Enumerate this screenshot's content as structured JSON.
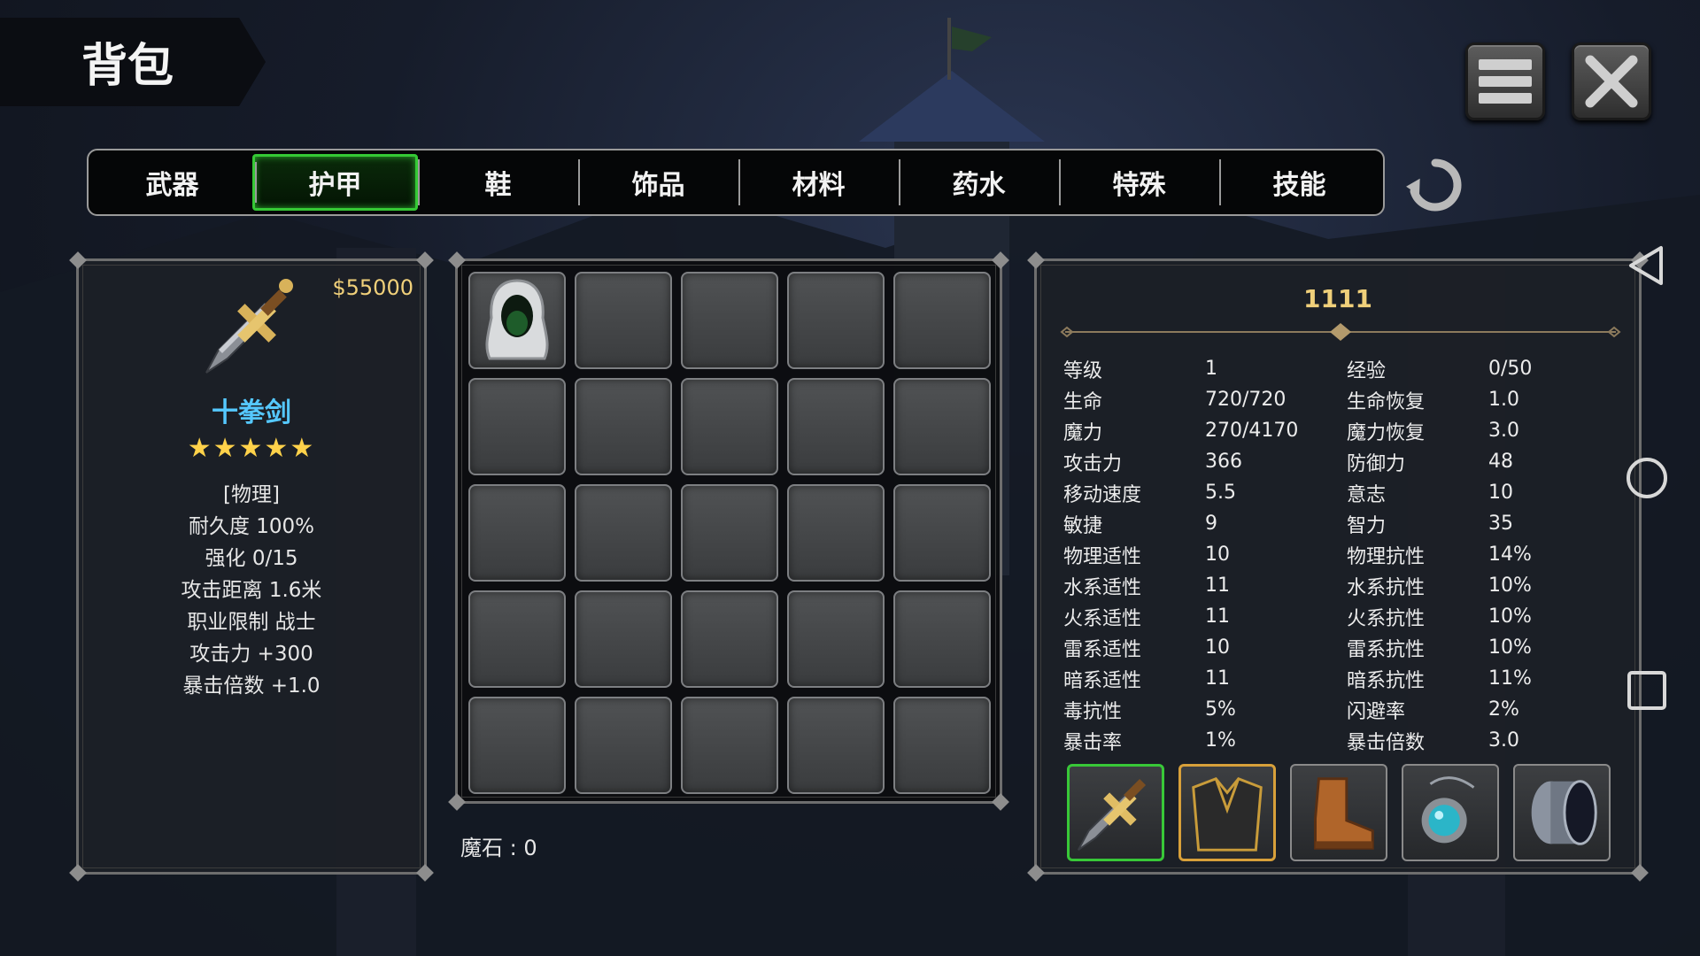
{
  "header": {
    "title": "背包"
  },
  "tabs": [
    {
      "label": "武器",
      "active": false
    },
    {
      "label": "护甲",
      "active": true
    },
    {
      "label": "鞋",
      "active": false
    },
    {
      "label": "饰品",
      "active": false
    },
    {
      "label": "材料",
      "active": false
    },
    {
      "label": "药水",
      "active": false
    },
    {
      "label": "特殊",
      "active": false
    },
    {
      "label": "技能",
      "active": false
    }
  ],
  "item_detail": {
    "price": "$55000",
    "icon": "sword-icon",
    "name": "十拳剑",
    "stars": "★★★★★",
    "rating": 5,
    "lines": [
      "[物理]",
      "耐久度 100%",
      "强化 0/15",
      "攻击距离  1.6米",
      "职业限制  战士",
      "攻击力  +300",
      "暴击倍数  +1.0"
    ]
  },
  "inventory": {
    "slots_total": 25,
    "items": [
      {
        "icon": "hood-cloak-icon"
      }
    ],
    "magic_stone": "魔石 : 0"
  },
  "character": {
    "name": "1111",
    "stats": [
      [
        "等级",
        "1",
        "经验",
        "0/50"
      ],
      [
        "生命",
        "720/720",
        "生命恢复",
        "1.0"
      ],
      [
        "魔力",
        "270/4170",
        "魔力恢复",
        "3.0"
      ],
      [
        "攻击力",
        "366",
        "防御力",
        "48"
      ],
      [
        "移动速度",
        "5.5",
        "意志",
        "10"
      ],
      [
        "敏捷",
        "9",
        "智力",
        "35"
      ],
      [
        "物理适性",
        "10",
        "物理抗性",
        "14%"
      ],
      [
        "水系适性",
        "11",
        "水系抗性",
        "10%"
      ],
      [
        "火系适性",
        "11",
        "火系抗性",
        "10%"
      ],
      [
        "雷系适性",
        "10",
        "雷系抗性",
        "10%"
      ],
      [
        "暗系适性",
        "11",
        "暗系抗性",
        "11%"
      ],
      [
        "毒抗性",
        "5%",
        "闪避率",
        "2%"
      ],
      [
        "暴击率",
        "1%",
        "暴击倍数",
        "3.0"
      ]
    ],
    "equipment": [
      {
        "icon": "sword-icon",
        "border": "#38c838"
      },
      {
        "icon": "armor-icon",
        "border": "#d8a03a"
      },
      {
        "icon": "boots-icon",
        "border": "#8a8a8a"
      },
      {
        "icon": "amulet-icon",
        "border": "#8a8a8a"
      },
      {
        "icon": "bracer-icon",
        "border": "#8a8a8a"
      }
    ]
  },
  "colors": {
    "price": "#f0d07a",
    "item_name": "#55c8ff",
    "stars": "#ffd24a",
    "active_tab": "#35c935"
  }
}
